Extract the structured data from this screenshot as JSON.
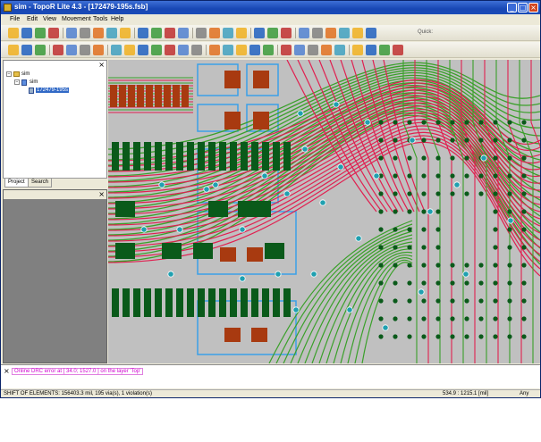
{
  "window": {
    "title": "sim - TopoR Lite 4.3 - [172479-195s.fsb]",
    "controls": {
      "minimize": "_",
      "maximize": "□",
      "close": "×"
    }
  },
  "menu": {
    "items": [
      "File",
      "Edit",
      "View",
      "Movement",
      "Tools",
      "Help"
    ]
  },
  "toolbar": {
    "quick_label": "Quick:",
    "row1_icons": [
      "open-icon",
      "save-icon",
      "view-icon",
      "window-icon",
      "settings-icon",
      "prev-icon",
      "layers-icon",
      "router-icon",
      "check-icon",
      "check2-icon",
      "play-icon",
      "stop-icon",
      "verify-icon",
      "drc-icon",
      "color-icon",
      "arc-icon",
      "square-icon",
      "export-icon",
      "refresh-icon",
      "copy-icon",
      "paste-icon",
      "zoom-icon",
      "search-icon",
      "help-icon",
      "about-icon",
      "info-icon"
    ],
    "row2_icons": [
      "tool1-icon",
      "tool2-icon",
      "tool3-icon",
      "tool4-icon",
      "tool5-icon",
      "tool6-icon",
      "tool7-icon",
      "tool8-icon",
      "tool9-icon",
      "tool10-icon",
      "tool11-icon",
      "tool12-icon",
      "tool13-icon",
      "tool14-icon",
      "pointer-icon",
      "wire-icon",
      "via-icon",
      "route-icon",
      "move-icon",
      "rotate-icon",
      "mirror-icon",
      "align-icon",
      "layer-icon",
      "grid-icon",
      "snap-icon",
      "measure-icon",
      "component-icon",
      "net-icon"
    ]
  },
  "project_panel": {
    "tree": {
      "root": "sim",
      "child": "sim",
      "file": "172479-195s"
    },
    "tabs": [
      "Project",
      "Search"
    ]
  },
  "messages": {
    "line": "Online DRC error at [ 34.0; 1527.0 ] on the layer 'Top'"
  },
  "status": {
    "left": "SHIFT OF ELEMENTS: 156403.3 mil, 195 via(s), 1 violation(s)",
    "coords": "534.9 : 1215.1 [mil]",
    "mode": "Any"
  },
  "colors": {
    "board_bg": "#c0c0c0",
    "trace_red": "#e02050",
    "trace_green": "#3aa02a",
    "pad_green": "#0a5a1a",
    "pad_brown": "#a83a10",
    "outline_blue": "#3aa0e8",
    "via_teal": "#20a0b0"
  }
}
